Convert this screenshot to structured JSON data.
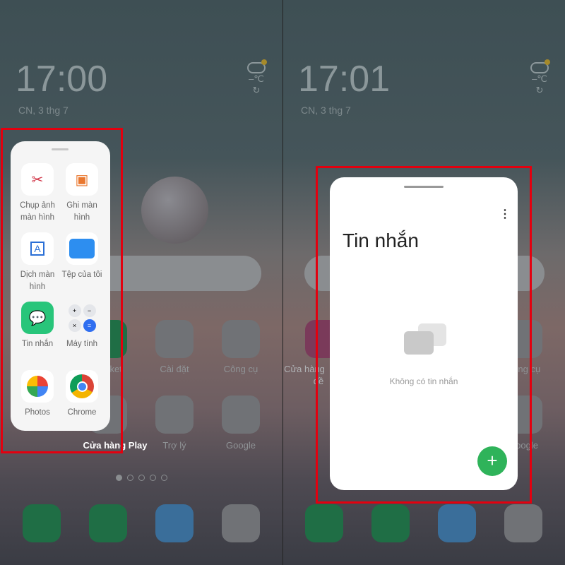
{
  "left": {
    "clock": "17:00",
    "date": "CN, 3 thg 7",
    "temp": "–℃",
    "sidebar_apps": [
      {
        "label": "Chụp ảnh màn hình",
        "icon": "screenshot-icon"
      },
      {
        "label": "Ghi màn hình",
        "icon": "screen-record-icon"
      },
      {
        "label": "Dịch màn hình",
        "icon": "translate-icon"
      },
      {
        "label": "Tệp của tôi",
        "icon": "folder-icon"
      },
      {
        "label": "Tin nhắn",
        "icon": "messages-icon"
      },
      {
        "label": "Máy tính",
        "icon": "calculator-icon"
      },
      {
        "label": "Photos",
        "icon": "photos-icon"
      },
      {
        "label": "Chrome",
        "icon": "chrome-icon"
      }
    ],
    "home_labels": [
      "Market",
      "Cài đặt",
      "Công cụ",
      "Cửa hàng Play",
      "Trợ lý",
      "Google"
    ]
  },
  "right": {
    "clock": "17:01",
    "date": "CN, 3 thg 7",
    "temp": "–℃",
    "app_title": "Tin nhắn",
    "empty_text": "Không có tin nhắn",
    "fab": "+",
    "menu": "⋮",
    "home_labels": [
      "Cửa hàng",
      "đề",
      "Công cụ",
      "Google"
    ]
  },
  "colors": {
    "highlight": "#e3000f",
    "fab": "#2fb35a"
  }
}
